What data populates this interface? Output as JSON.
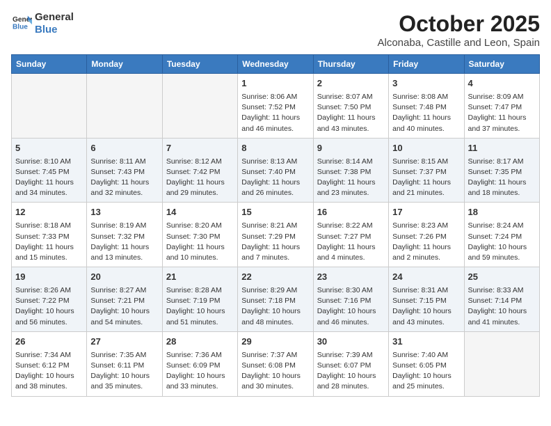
{
  "header": {
    "logo_line1": "General",
    "logo_line2": "Blue",
    "title": "October 2025",
    "subtitle": "Alconaba, Castille and Leon, Spain"
  },
  "weekdays": [
    "Sunday",
    "Monday",
    "Tuesday",
    "Wednesday",
    "Thursday",
    "Friday",
    "Saturday"
  ],
  "weeks": [
    [
      {
        "day": "",
        "info": ""
      },
      {
        "day": "",
        "info": ""
      },
      {
        "day": "",
        "info": ""
      },
      {
        "day": "1",
        "info": "Sunrise: 8:06 AM\nSunset: 7:52 PM\nDaylight: 11 hours and 46 minutes."
      },
      {
        "day": "2",
        "info": "Sunrise: 8:07 AM\nSunset: 7:50 PM\nDaylight: 11 hours and 43 minutes."
      },
      {
        "day": "3",
        "info": "Sunrise: 8:08 AM\nSunset: 7:48 PM\nDaylight: 11 hours and 40 minutes."
      },
      {
        "day": "4",
        "info": "Sunrise: 8:09 AM\nSunset: 7:47 PM\nDaylight: 11 hours and 37 minutes."
      }
    ],
    [
      {
        "day": "5",
        "info": "Sunrise: 8:10 AM\nSunset: 7:45 PM\nDaylight: 11 hours and 34 minutes."
      },
      {
        "day": "6",
        "info": "Sunrise: 8:11 AM\nSunset: 7:43 PM\nDaylight: 11 hours and 32 minutes."
      },
      {
        "day": "7",
        "info": "Sunrise: 8:12 AM\nSunset: 7:42 PM\nDaylight: 11 hours and 29 minutes."
      },
      {
        "day": "8",
        "info": "Sunrise: 8:13 AM\nSunset: 7:40 PM\nDaylight: 11 hours and 26 minutes."
      },
      {
        "day": "9",
        "info": "Sunrise: 8:14 AM\nSunset: 7:38 PM\nDaylight: 11 hours and 23 minutes."
      },
      {
        "day": "10",
        "info": "Sunrise: 8:15 AM\nSunset: 7:37 PM\nDaylight: 11 hours and 21 minutes."
      },
      {
        "day": "11",
        "info": "Sunrise: 8:17 AM\nSunset: 7:35 PM\nDaylight: 11 hours and 18 minutes."
      }
    ],
    [
      {
        "day": "12",
        "info": "Sunrise: 8:18 AM\nSunset: 7:33 PM\nDaylight: 11 hours and 15 minutes."
      },
      {
        "day": "13",
        "info": "Sunrise: 8:19 AM\nSunset: 7:32 PM\nDaylight: 11 hours and 13 minutes."
      },
      {
        "day": "14",
        "info": "Sunrise: 8:20 AM\nSunset: 7:30 PM\nDaylight: 11 hours and 10 minutes."
      },
      {
        "day": "15",
        "info": "Sunrise: 8:21 AM\nSunset: 7:29 PM\nDaylight: 11 hours and 7 minutes."
      },
      {
        "day": "16",
        "info": "Sunrise: 8:22 AM\nSunset: 7:27 PM\nDaylight: 11 hours and 4 minutes."
      },
      {
        "day": "17",
        "info": "Sunrise: 8:23 AM\nSunset: 7:26 PM\nDaylight: 11 hours and 2 minutes."
      },
      {
        "day": "18",
        "info": "Sunrise: 8:24 AM\nSunset: 7:24 PM\nDaylight: 10 hours and 59 minutes."
      }
    ],
    [
      {
        "day": "19",
        "info": "Sunrise: 8:26 AM\nSunset: 7:22 PM\nDaylight: 10 hours and 56 minutes."
      },
      {
        "day": "20",
        "info": "Sunrise: 8:27 AM\nSunset: 7:21 PM\nDaylight: 10 hours and 54 minutes."
      },
      {
        "day": "21",
        "info": "Sunrise: 8:28 AM\nSunset: 7:19 PM\nDaylight: 10 hours and 51 minutes."
      },
      {
        "day": "22",
        "info": "Sunrise: 8:29 AM\nSunset: 7:18 PM\nDaylight: 10 hours and 48 minutes."
      },
      {
        "day": "23",
        "info": "Sunrise: 8:30 AM\nSunset: 7:16 PM\nDaylight: 10 hours and 46 minutes."
      },
      {
        "day": "24",
        "info": "Sunrise: 8:31 AM\nSunset: 7:15 PM\nDaylight: 10 hours and 43 minutes."
      },
      {
        "day": "25",
        "info": "Sunrise: 8:33 AM\nSunset: 7:14 PM\nDaylight: 10 hours and 41 minutes."
      }
    ],
    [
      {
        "day": "26",
        "info": "Sunrise: 7:34 AM\nSunset: 6:12 PM\nDaylight: 10 hours and 38 minutes."
      },
      {
        "day": "27",
        "info": "Sunrise: 7:35 AM\nSunset: 6:11 PM\nDaylight: 10 hours and 35 minutes."
      },
      {
        "day": "28",
        "info": "Sunrise: 7:36 AM\nSunset: 6:09 PM\nDaylight: 10 hours and 33 minutes."
      },
      {
        "day": "29",
        "info": "Sunrise: 7:37 AM\nSunset: 6:08 PM\nDaylight: 10 hours and 30 minutes."
      },
      {
        "day": "30",
        "info": "Sunrise: 7:39 AM\nSunset: 6:07 PM\nDaylight: 10 hours and 28 minutes."
      },
      {
        "day": "31",
        "info": "Sunrise: 7:40 AM\nSunset: 6:05 PM\nDaylight: 10 hours and 25 minutes."
      },
      {
        "day": "",
        "info": ""
      }
    ]
  ]
}
